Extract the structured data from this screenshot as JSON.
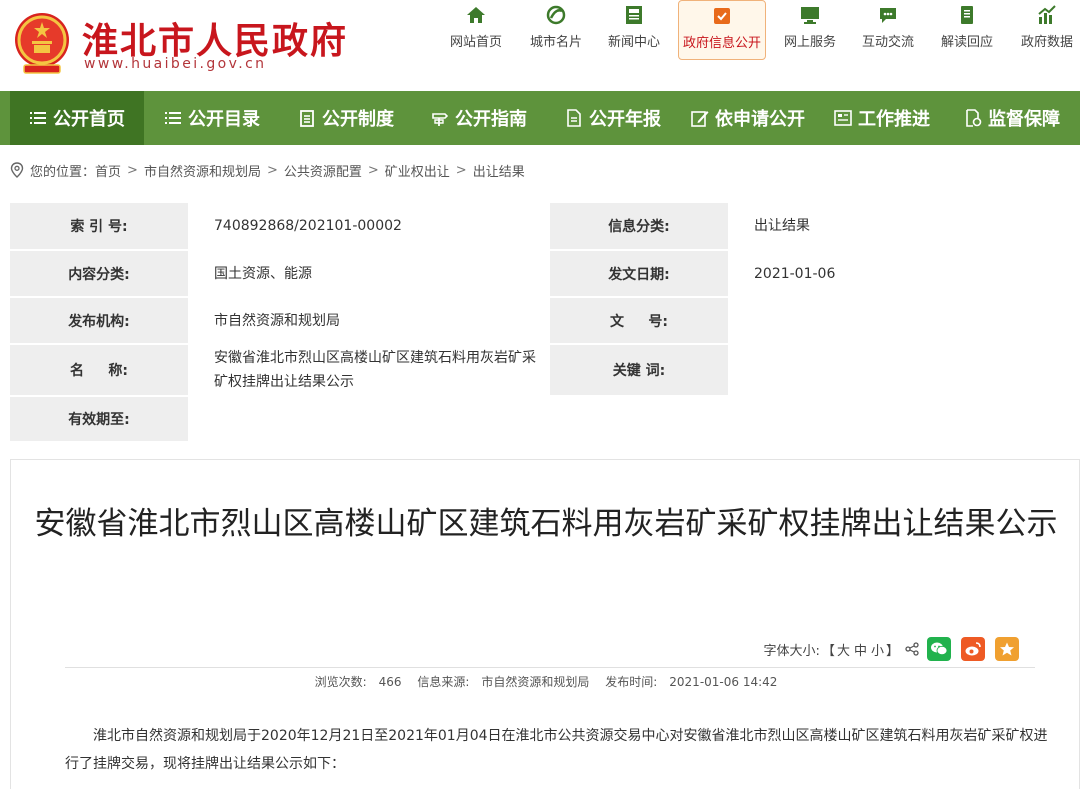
{
  "header": {
    "site_title": "淮北市人民政府",
    "site_url": "www.huaibei.gov.cn",
    "quick_nav": [
      {
        "label": "网站首页",
        "icon": "home-icon"
      },
      {
        "label": "城市名片",
        "icon": "leaf-icon"
      },
      {
        "label": "新闻中心",
        "icon": "newspaper-icon"
      },
      {
        "label": "政府信息公开",
        "icon": "document-icon",
        "active": true
      },
      {
        "label": "网上服务",
        "icon": "monitor-icon"
      },
      {
        "label": "互动交流",
        "icon": "chat-icon"
      },
      {
        "label": "解读回应",
        "icon": "book-icon"
      },
      {
        "label": "政府数据",
        "icon": "chart-icon"
      }
    ]
  },
  "nav": {
    "items": [
      {
        "label": "公开首页",
        "icon": "list-icon",
        "active": true
      },
      {
        "label": "公开目录",
        "icon": "list-icon"
      },
      {
        "label": "公开制度",
        "icon": "clipboard-icon"
      },
      {
        "label": "公开指南",
        "icon": "guide-icon"
      },
      {
        "label": "公开年报",
        "icon": "report-icon"
      },
      {
        "label": "依申请公开",
        "icon": "edit-icon"
      },
      {
        "label": "工作推进",
        "icon": "panel-icon"
      },
      {
        "label": "监督保障",
        "icon": "shield-doc-icon"
      }
    ]
  },
  "breadcrumb": {
    "prefix": "您的位置：",
    "items": [
      "首页",
      "市自然资源和规划局",
      "公共资源配置",
      "矿业权出让",
      "出让结果"
    ],
    "separator": ">"
  },
  "info": {
    "index_label": "索 引 号:",
    "index_value": "740892868/202101-00002",
    "category_label": "信息分类:",
    "category_value": "出让结果",
    "content_label": "内容分类:",
    "content_value": "国土资源、能源",
    "date_label": "发文日期:",
    "date_value": "2021-01-06",
    "org_label": "发布机构:",
    "org_value": "市自然资源和规划局",
    "docno_label": "文     号:",
    "docno_value": "",
    "name_label": "名     称:",
    "name_value": "安徽省淮北市烈山区高楼山矿区建筑石料用灰岩矿采矿权挂牌出让结果公示",
    "keyword_label": "关键 词:",
    "keyword_value": "",
    "validity_label": "有效期至:",
    "validity_value": ""
  },
  "article": {
    "title": "安徽省淮北市烈山区高楼山矿区建筑石料用灰岩矿采矿权挂牌出让结果公示",
    "font_size_label": "字体大小:",
    "font_size_open": "【",
    "font_big": "大",
    "font_mid": "中",
    "font_small": "小",
    "font_size_close": "】",
    "views_label": "浏览次数:",
    "views_value": "466",
    "source_label": "信息来源:",
    "source_value": "市自然资源和规划局",
    "time_label": "发布时间:",
    "time_value": "2021-01-06 14:42",
    "body": "淮北市自然资源和规划局于2020年12月21日至2021年01月04日在淮北市公共资源交易中心对安徽省淮北市烈山区高楼山矿区建筑石料用灰岩矿采矿权进行了挂牌交易，现将挂牌出让结果公示如下："
  },
  "colors": {
    "brand_red": "#c8161d",
    "nav_green": "#5e933c",
    "nav_active_green": "#3f7423",
    "wechat_green": "#21b24d",
    "weibo_orange": "#ee5a24",
    "favorite_orange": "#f0a030"
  }
}
